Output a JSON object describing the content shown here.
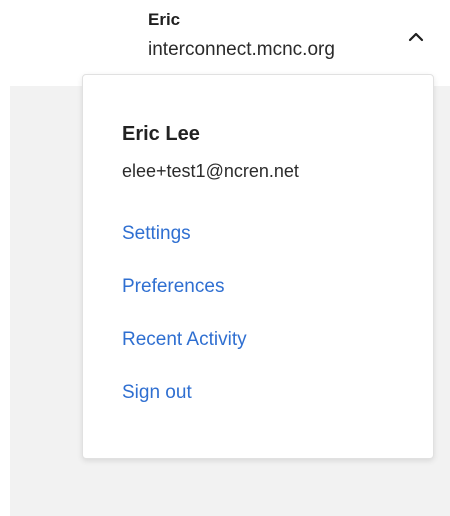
{
  "account": {
    "short_name": "Eric",
    "organization": "interconnect.mcnc.org",
    "toggle_icon": "chevron-up-icon"
  },
  "menu": {
    "user_name": "Eric Lee",
    "user_email": "elee+test1@ncren.net",
    "items": [
      {
        "label": "Settings"
      },
      {
        "label": "Preferences"
      },
      {
        "label": "Recent Activity"
      },
      {
        "label": "Sign out"
      }
    ]
  },
  "colors": {
    "link": "#2f6fd1",
    "backdrop": "#f2f2f2",
    "text": "#222222"
  }
}
